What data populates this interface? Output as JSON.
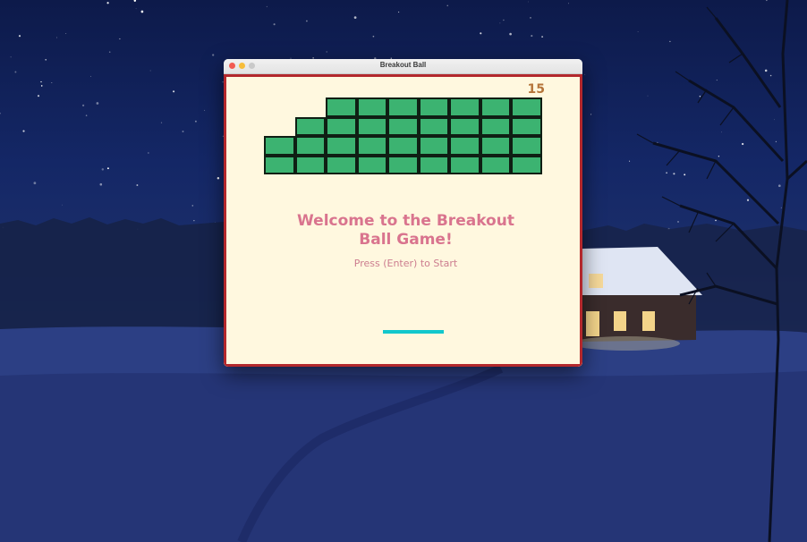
{
  "window": {
    "title": "Breakout Ball"
  },
  "game": {
    "score": "15",
    "welcome_line1": "Welcome to the Breakout",
    "welcome_line2": "Ball Game!",
    "prompt": "Press (Enter) to Start",
    "brick_color": "#3cb371",
    "paddle_color": "#12c7cc",
    "border_color": "#b3282c",
    "background_color": "#fff8df",
    "brick_rows": [
      {
        "row": 1,
        "present": [
          false,
          false,
          true,
          true,
          true,
          true,
          true,
          true,
          true
        ]
      },
      {
        "row": 2,
        "present": [
          false,
          true,
          true,
          true,
          true,
          true,
          true,
          true,
          true
        ]
      },
      {
        "row": 3,
        "present": [
          true,
          true,
          true,
          true,
          true,
          true,
          true,
          true,
          true
        ]
      },
      {
        "row": 4,
        "present": [
          true,
          true,
          true,
          true,
          true,
          true,
          true,
          true,
          true
        ]
      }
    ]
  }
}
